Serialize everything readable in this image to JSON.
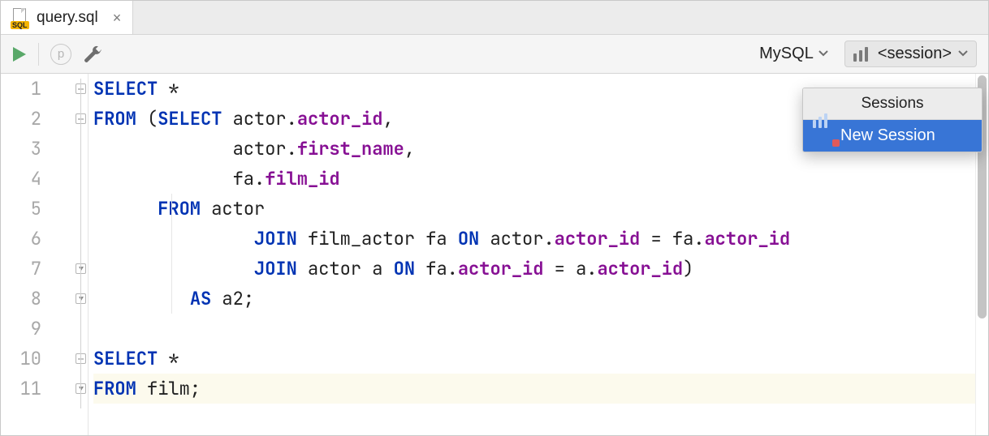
{
  "tab": {
    "filename": "query.sql",
    "icon_badge": "SQL"
  },
  "toolbar": {
    "run_title": "Run",
    "p_label": "p",
    "wrench_title": "Settings",
    "database_label": "MySQL",
    "session_label": "<session>"
  },
  "sessions_popup": {
    "header": "Sessions",
    "new_session_label": "New Session"
  },
  "editor": {
    "line_count": 11,
    "highlighted_line": 11,
    "lines": [
      [
        {
          "t": "SELECT",
          "c": "kw"
        },
        {
          "t": " *",
          "c": "plain"
        }
      ],
      [
        {
          "t": "FROM",
          "c": "kw"
        },
        {
          "t": " (",
          "c": "plain"
        },
        {
          "t": "SELECT",
          "c": "kw"
        },
        {
          "t": " actor.",
          "c": "plain"
        },
        {
          "t": "actor_id",
          "c": "id"
        },
        {
          "t": ",",
          "c": "plain"
        }
      ],
      [
        {
          "t": "             actor.",
          "c": "plain"
        },
        {
          "t": "first_name",
          "c": "id"
        },
        {
          "t": ",",
          "c": "plain"
        }
      ],
      [
        {
          "t": "             fa.",
          "c": "plain"
        },
        {
          "t": "film_id",
          "c": "id"
        }
      ],
      [
        {
          "t": "      ",
          "c": "plain"
        },
        {
          "t": "FROM",
          "c": "kw"
        },
        {
          "t": " actor",
          "c": "plain"
        }
      ],
      [
        {
          "t": "               ",
          "c": "plain"
        },
        {
          "t": "JOIN",
          "c": "kw"
        },
        {
          "t": " film_actor fa ",
          "c": "plain"
        },
        {
          "t": "ON",
          "c": "kw"
        },
        {
          "t": " actor.",
          "c": "plain"
        },
        {
          "t": "actor_id",
          "c": "id"
        },
        {
          "t": " = fa.",
          "c": "plain"
        },
        {
          "t": "actor_id",
          "c": "id"
        }
      ],
      [
        {
          "t": "               ",
          "c": "plain"
        },
        {
          "t": "JOIN",
          "c": "kw"
        },
        {
          "t": " actor a ",
          "c": "plain"
        },
        {
          "t": "ON",
          "c": "kw"
        },
        {
          "t": " fa.",
          "c": "plain"
        },
        {
          "t": "actor_id",
          "c": "id"
        },
        {
          "t": " = a.",
          "c": "plain"
        },
        {
          "t": "actor_id",
          "c": "id"
        },
        {
          "t": ")",
          "c": "plain"
        }
      ],
      [
        {
          "t": "         ",
          "c": "plain"
        },
        {
          "t": "AS",
          "c": "kw"
        },
        {
          "t": " a2;",
          "c": "plain"
        }
      ],
      [],
      [
        {
          "t": "SELECT",
          "c": "kw"
        },
        {
          "t": " *",
          "c": "plain"
        }
      ],
      [
        {
          "t": "FROM",
          "c": "kw"
        },
        {
          "t": " film;",
          "c": "plain"
        }
      ]
    ],
    "fold_markers": [
      {
        "line": 1,
        "kind": "minus"
      },
      {
        "line": 2,
        "kind": "minus"
      },
      {
        "line": 7,
        "kind": "down"
      },
      {
        "line": 8,
        "kind": "down"
      },
      {
        "line": 10,
        "kind": "minus"
      },
      {
        "line": 11,
        "kind": "down"
      }
    ],
    "indent_guide": {
      "from_line": 5,
      "to_line": 8
    }
  }
}
